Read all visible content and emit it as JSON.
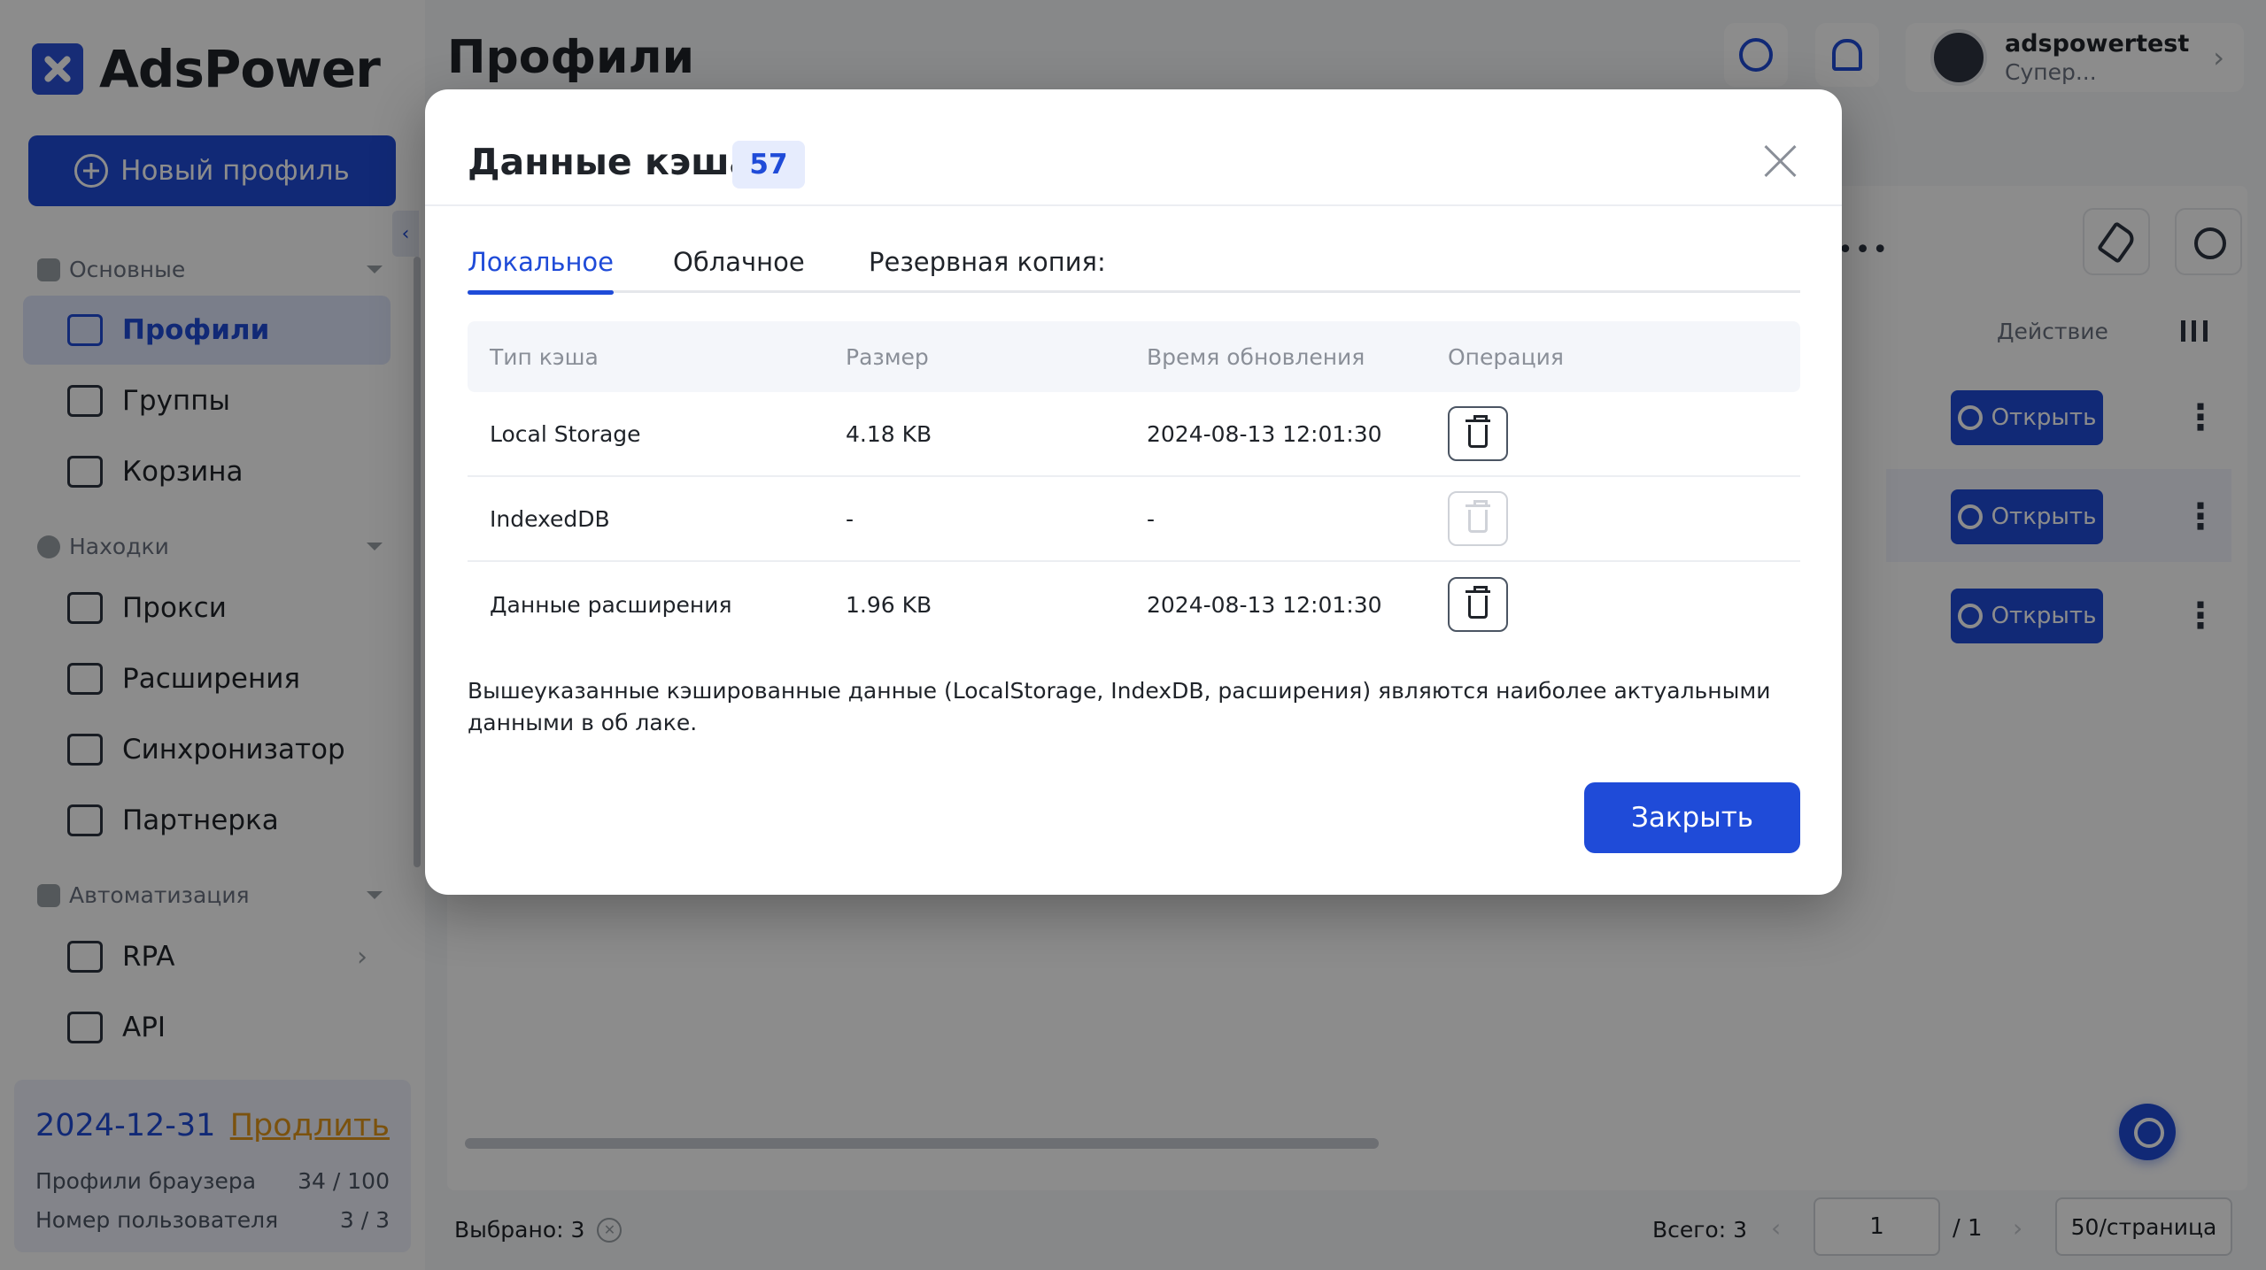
{
  "app": {
    "logo_text": "AdsPower",
    "new_profile_label": "Новый профиль"
  },
  "sidebar": {
    "sections": [
      {
        "label": "Основные"
      },
      {
        "label": "Находки"
      },
      {
        "label": "Автоматизация"
      }
    ],
    "items": [
      {
        "label": "Профили",
        "icon": "profiles-icon",
        "active": true
      },
      {
        "label": "Группы",
        "icon": "folder-icon"
      },
      {
        "label": "Корзина",
        "icon": "trash-icon"
      },
      {
        "label": "Прокси",
        "icon": "proxy-icon"
      },
      {
        "label": "Расширения",
        "icon": "puzzle-icon"
      },
      {
        "label": "Синхронизатор",
        "icon": "sync-icon"
      },
      {
        "label": "Партнерка",
        "icon": "star-icon"
      },
      {
        "label": "RPA",
        "icon": "robot-icon"
      },
      {
        "label": "API",
        "icon": "plug-icon"
      }
    ],
    "subscription": {
      "date": "2024-12-31",
      "renew_label": "Продлить",
      "browser_profiles_label": "Профили браузера",
      "browser_profiles_value": "34 / 100",
      "users_label": "Номер пользователя",
      "users_value": "3 / 3"
    }
  },
  "header": {
    "title": "Профили",
    "user": {
      "name": "adspowertest",
      "role": "Супер..."
    }
  },
  "table": {
    "action_header": "Действие",
    "open_label": "Открыть"
  },
  "footer": {
    "selected": "Выбрано: 3",
    "total": "Всего: 3",
    "page": "1",
    "page_total": "/ 1",
    "per_page": "50/страница"
  },
  "modal": {
    "title": "Данные кэша",
    "badge": "57",
    "tabs": [
      {
        "label": "Локальное",
        "active": true
      },
      {
        "label": "Облачное"
      },
      {
        "label": "Резервная копия:"
      }
    ],
    "columns": [
      "Тип кэша",
      "Размер",
      "Время обновления",
      "Операция"
    ],
    "rows": [
      {
        "type": "Local Storage",
        "size": "4.18 KB",
        "updated": "2024-08-13 12:01:30",
        "enabled": true
      },
      {
        "type": "IndexedDB",
        "size": "-",
        "updated": "-",
        "enabled": false
      },
      {
        "type": "Данные расширения",
        "size": "1.96 KB",
        "updated": "2024-08-13 12:01:30",
        "enabled": true
      }
    ],
    "note": "Вышеуказанные кэшированные данные (LocalStorage, IndexDB, расширения) являются наиболее актуальными данными в об лаке.",
    "close_label": "Закрыть"
  },
  "colors": {
    "accent": "#1f4bd8",
    "renew": "#e0951b"
  }
}
